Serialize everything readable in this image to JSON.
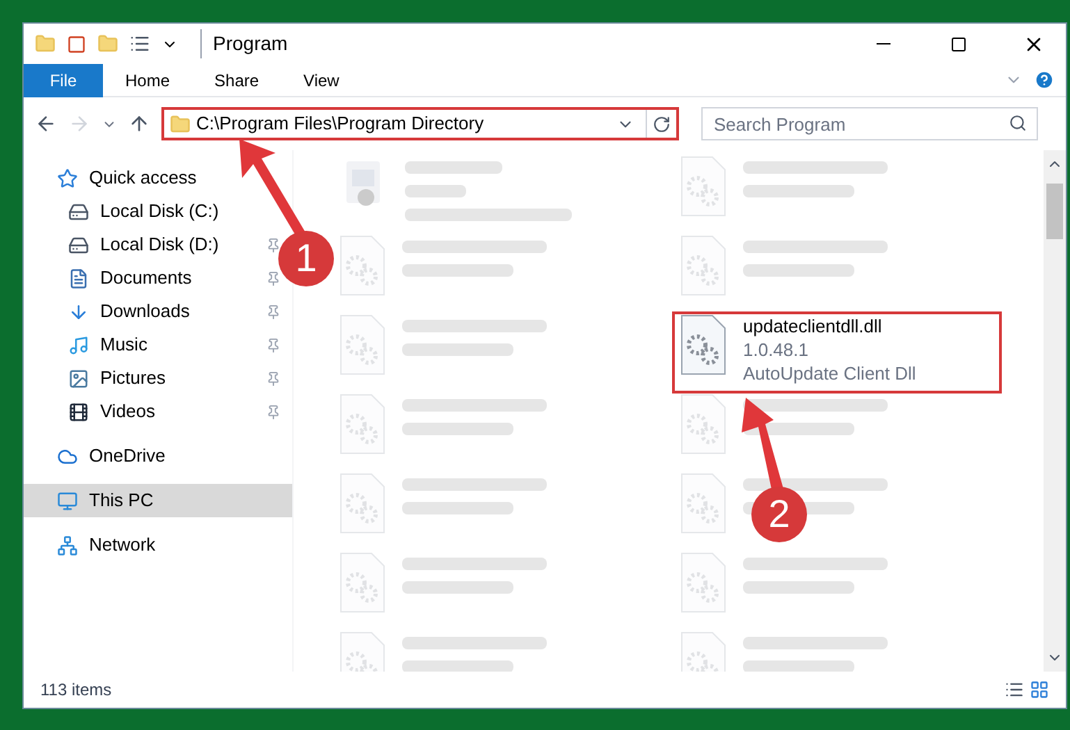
{
  "window": {
    "title": "Program"
  },
  "ribbon_tabs": [
    {
      "label": "File",
      "selected": true
    },
    {
      "label": "Home",
      "selected": false
    },
    {
      "label": "Share",
      "selected": false
    },
    {
      "label": "View",
      "selected": false
    }
  ],
  "address": {
    "path": "C:\\Program Files\\Program Directory"
  },
  "search": {
    "placeholder": "Search Program"
  },
  "sidebar": {
    "items": [
      {
        "label": "Quick access",
        "kind": "star",
        "selected": false,
        "children": [
          {
            "label": "Local Disk (C:)",
            "kind": "disk-c",
            "pinned": false
          },
          {
            "label": "Local Disk (D:)",
            "kind": "disk",
            "pinned": true
          },
          {
            "label": "Documents",
            "kind": "documents",
            "pinned": true
          },
          {
            "label": "Downloads",
            "kind": "downloads",
            "pinned": true
          },
          {
            "label": "Music",
            "kind": "music",
            "pinned": true
          },
          {
            "label": "Pictures",
            "kind": "pictures",
            "pinned": true
          },
          {
            "label": "Videos",
            "kind": "videos",
            "pinned": true
          }
        ]
      },
      {
        "label": "OneDrive",
        "kind": "cloud",
        "selected": false
      },
      {
        "label": "This PC",
        "kind": "pc",
        "selected": true
      },
      {
        "label": "Network",
        "kind": "network",
        "selected": false
      }
    ]
  },
  "files": [
    {
      "kind": "blurred-exe"
    },
    {
      "kind": "blurred-dll"
    },
    {
      "kind": "blurred-dll"
    },
    {
      "kind": "blurred-dll"
    },
    {
      "kind": "blurred-dll"
    },
    {
      "kind": "file",
      "name": "updateclientdll.dll",
      "lines": [
        "1.0.48.1",
        "AutoUpdate Client Dll"
      ]
    },
    {
      "kind": "blurred-dll"
    },
    {
      "kind": "blurred-dll"
    },
    {
      "kind": "blurred-dll"
    },
    {
      "kind": "blurred-dll"
    },
    {
      "kind": "blurred-dll"
    },
    {
      "kind": "blurred-dll"
    },
    {
      "kind": "blurred-dll"
    },
    {
      "kind": "blurred-dll"
    }
  ],
  "status_bar": {
    "count": "113 items"
  },
  "callouts": [
    "1",
    "2"
  ]
}
